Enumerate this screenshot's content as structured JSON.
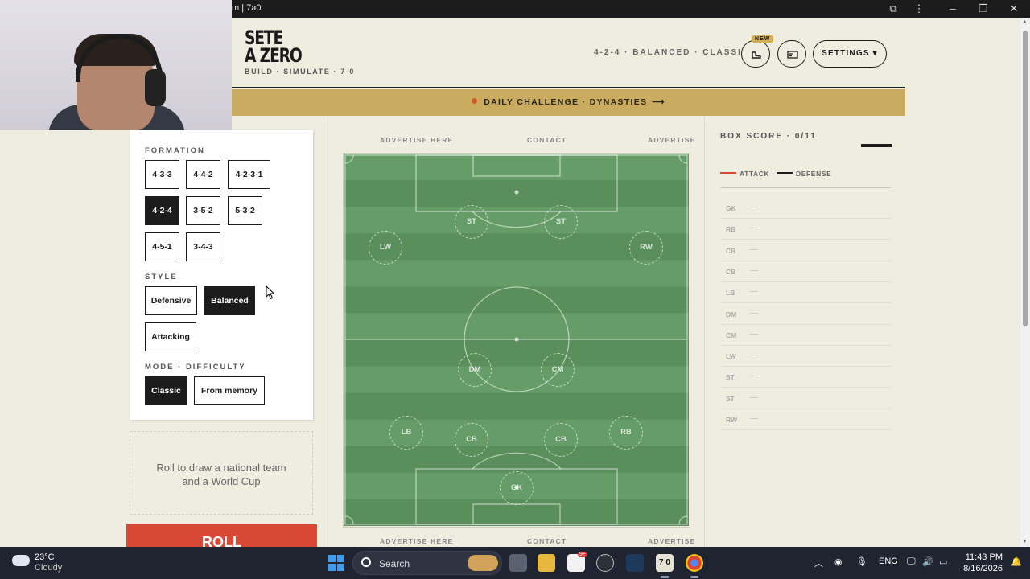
{
  "browser": {
    "title": "m | 7a0"
  },
  "header": {
    "logo_line1": "SETE",
    "logo_line2": "A ZERO",
    "tagline": "BUILD · SIMULATE · 7-0",
    "summary": "4-2-4 · BALANCED · CLASSIC",
    "new_badge": "NEW",
    "settings_label": "SETTINGS ▾"
  },
  "banner": {
    "text": "DAILY CHALLENGE · DYNASTIES",
    "arrow": "⟶",
    "dot_color": "#d45a2a"
  },
  "sidebar": {
    "formation_label": "FORMATION",
    "formations": [
      "4-3-3",
      "4-4-2",
      "4-2-3-1",
      "4-2-4",
      "3-5-2",
      "5-3-2",
      "4-5-1",
      "3-4-3"
    ],
    "selected_formation": "4-2-4",
    "style_label": "STYLE",
    "styles": [
      "Defensive",
      "Balanced",
      "Attacking"
    ],
    "selected_style": "Balanced",
    "mode_label": "MODE · DIFFICULTY",
    "modes": [
      "Classic",
      "From memory"
    ],
    "selected_mode": "Classic"
  },
  "roll": {
    "hint_line1": "Roll to draw a national team",
    "hint_line2": "and a World Cup",
    "button_label": "ROLL"
  },
  "ads": {
    "top": [
      "ADVERTISE HERE",
      "CONTACT",
      "ADVERTISE"
    ],
    "bottom": [
      "ADVERTISE HERE",
      "CONTACT",
      "ADVERTISE"
    ]
  },
  "pitch": {
    "players": [
      "ST",
      "ST",
      "LW",
      "RW",
      "DM",
      "CM",
      "LB",
      "CB",
      "CB",
      "RB",
      "GK"
    ],
    "colors": {
      "light": "#669c68",
      "dark": "#5a8f5c"
    }
  },
  "box_score": {
    "title": "BOX SCORE · 0/11",
    "legend_attack": "ATTACK",
    "legend_defense": "DEFENSE",
    "attack_color": "#d74935",
    "defense_color": "#1c1c1c",
    "rows": [
      {
        "pos": "GK",
        "val": "—"
      },
      {
        "pos": "RB",
        "val": "—"
      },
      {
        "pos": "CB",
        "val": "—"
      },
      {
        "pos": "CB",
        "val": "—"
      },
      {
        "pos": "LB",
        "val": "—"
      },
      {
        "pos": "DM",
        "val": "—"
      },
      {
        "pos": "CM",
        "val": "—"
      },
      {
        "pos": "LW",
        "val": "—"
      },
      {
        "pos": "ST",
        "val": "—"
      },
      {
        "pos": "ST",
        "val": "—"
      },
      {
        "pos": "RW",
        "val": "—"
      }
    ]
  },
  "taskbar": {
    "weather_temp": "23°C",
    "weather_desc": "Cloudy",
    "search_label": "Search",
    "lang": "ENG",
    "time": "11:43 PM",
    "date": "8/16/2026",
    "app_label": "7 0",
    "badge_count": "9+"
  }
}
